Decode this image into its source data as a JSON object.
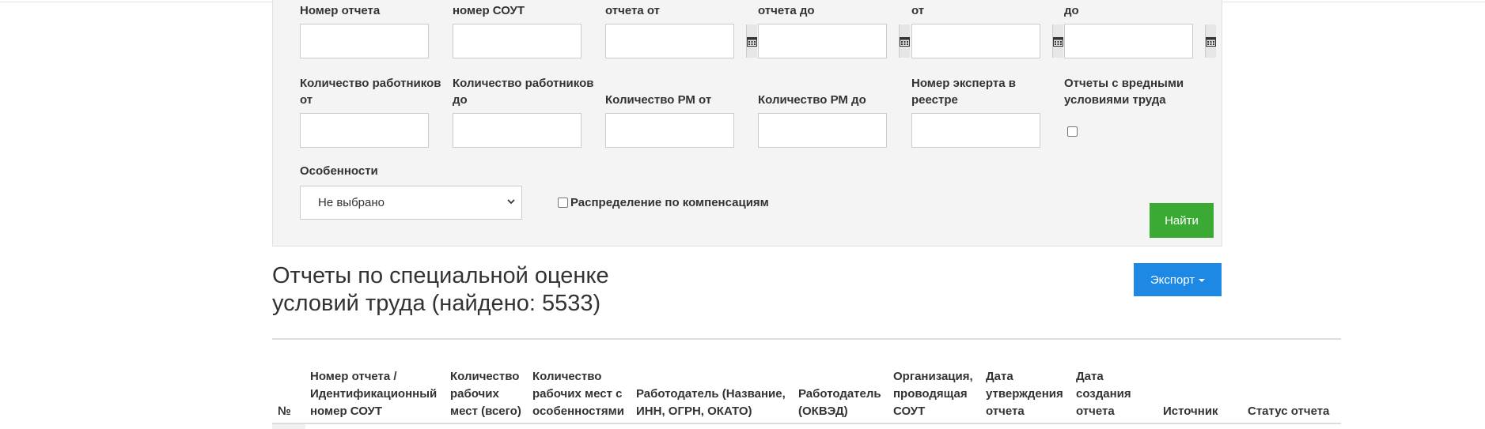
{
  "filters": {
    "report_number_label": "Номер отчета",
    "sout_number_label": "номер СОУТ",
    "report_date_from_label": "отчета от",
    "report_date_to_label": "отчета до",
    "date_from_label": "от",
    "date_to_label": "до",
    "workers_from_label": "Количество работников от",
    "workers_to_label": "Количество работников до",
    "rm_from_label": "Количество РМ от",
    "rm_to_label": "Количество РМ до",
    "expert_number_label": "Номер эксперта в реестре",
    "harmful_label": "Отчеты с вредными условиями труда",
    "features_label": "Особенности",
    "features_selected": "Не выбрано",
    "compensation_label": "Распределение по компенсациям",
    "find_button": "Найти"
  },
  "results": {
    "title": "Отчеты по специальной оценке условий труда (найдено: 5533)",
    "export_button": "Экспорт"
  },
  "table": {
    "columns": [
      "№",
      "Номер отчета / Идентификационный номер СОУТ",
      "Количество рабочих мест (всего)",
      "Количество рабочих мест с особенностями",
      "Работодатель (Название, ИНН, ОГРН, ОКАТО)",
      "Работодатель (ОКВЭД)",
      "Организация, проводящая СОУТ",
      "Дата утверждения отчета",
      "Дата создания отчета",
      "Источник",
      "Статус отчета"
    ]
  },
  "colors": {
    "find_button": "#3aaa35",
    "export_button": "#1e88e5",
    "panel_background": "#f4f4f4"
  }
}
